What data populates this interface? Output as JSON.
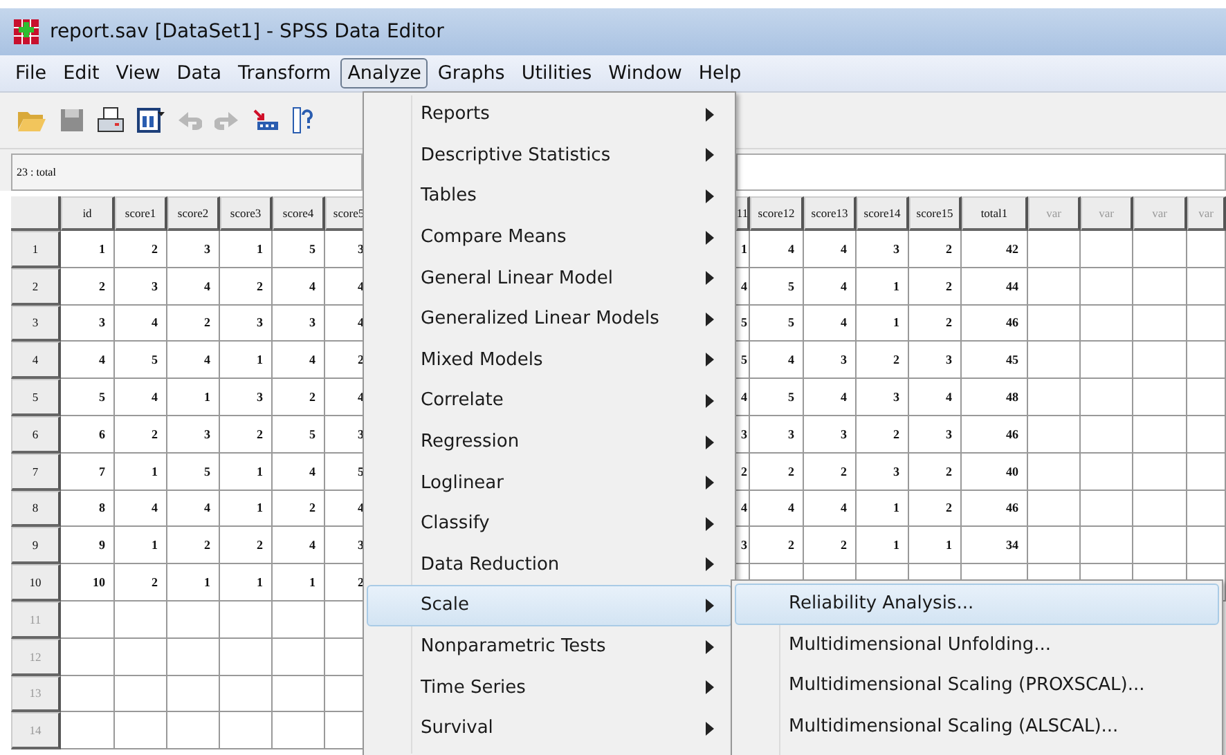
{
  "window": {
    "title": "report.sav [DataSet1] - SPSS Data Editor"
  },
  "menu_bar": [
    {
      "label": "File",
      "selected": false
    },
    {
      "label": "Edit",
      "selected": false
    },
    {
      "label": "View",
      "selected": false
    },
    {
      "label": "Data",
      "selected": false
    },
    {
      "label": "Transform",
      "selected": false
    },
    {
      "label": "Analyze",
      "selected": true
    },
    {
      "label": "Graphs",
      "selected": false
    },
    {
      "label": "Utilities",
      "selected": false
    },
    {
      "label": "Window",
      "selected": false
    },
    {
      "label": "Help",
      "selected": false
    }
  ],
  "cell_editor": {
    "reference": "23 : total"
  },
  "grid": {
    "row_headers": [
      {
        "label": "1",
        "filled": true
      },
      {
        "label": "2",
        "filled": true
      },
      {
        "label": "3",
        "filled": true
      },
      {
        "label": "4",
        "filled": true
      },
      {
        "label": "5",
        "filled": true
      },
      {
        "label": "6",
        "filled": true
      },
      {
        "label": "7",
        "filled": true
      },
      {
        "label": "8",
        "filled": true
      },
      {
        "label": "9",
        "filled": true
      },
      {
        "label": "10",
        "filled": true
      },
      {
        "label": "11",
        "filled": false
      },
      {
        "label": "12",
        "filled": false
      },
      {
        "label": "13",
        "filled": false
      },
      {
        "label": "14",
        "filled": false
      }
    ],
    "left": {
      "columns": [
        {
          "label": "id"
        },
        {
          "label": "score1"
        },
        {
          "label": "score2"
        },
        {
          "label": "score3"
        },
        {
          "label": "score4"
        },
        {
          "label": "score5"
        }
      ],
      "rows": [
        [
          "1",
          "2",
          "3",
          "1",
          "5",
          "3"
        ],
        [
          "2",
          "3",
          "4",
          "2",
          "4",
          "4"
        ],
        [
          "3",
          "4",
          "2",
          "3",
          "3",
          "4"
        ],
        [
          "4",
          "5",
          "4",
          "1",
          "4",
          "2"
        ],
        [
          "5",
          "4",
          "1",
          "3",
          "2",
          "4"
        ],
        [
          "6",
          "2",
          "3",
          "2",
          "5",
          "3"
        ],
        [
          "7",
          "1",
          "5",
          "1",
          "4",
          "5"
        ],
        [
          "8",
          "4",
          "4",
          "1",
          "2",
          "4"
        ],
        [
          "9",
          "1",
          "2",
          "2",
          "4",
          "3"
        ],
        [
          "10",
          "2",
          "1",
          "1",
          "1",
          "2"
        ],
        [],
        [],
        [],
        []
      ]
    },
    "right": {
      "columns": [
        {
          "label": "11",
          "kind": "variable"
        },
        {
          "label": "score12",
          "kind": "variable"
        },
        {
          "label": "score13",
          "kind": "variable"
        },
        {
          "label": "score14",
          "kind": "variable"
        },
        {
          "label": "score15",
          "kind": "variable"
        },
        {
          "label": "total1",
          "kind": "variable"
        },
        {
          "label": "var",
          "kind": "empty"
        },
        {
          "label": "var",
          "kind": "empty"
        },
        {
          "label": "var",
          "kind": "empty"
        },
        {
          "label": "var",
          "kind": "empty"
        }
      ],
      "rows": [
        [
          "1",
          "4",
          "4",
          "3",
          "2",
          "42"
        ],
        [
          "4",
          "5",
          "4",
          "1",
          "2",
          "44"
        ],
        [
          "5",
          "5",
          "4",
          "1",
          "2",
          "46"
        ],
        [
          "5",
          "4",
          "3",
          "2",
          "3",
          "45"
        ],
        [
          "4",
          "5",
          "4",
          "3",
          "4",
          "48"
        ],
        [
          "3",
          "3",
          "3",
          "2",
          "3",
          "46"
        ],
        [
          "2",
          "2",
          "2",
          "3",
          "2",
          "40"
        ],
        [
          "4",
          "4",
          "4",
          "1",
          "2",
          "46"
        ],
        [
          "3",
          "2",
          "2",
          "1",
          "1",
          "34"
        ],
        []
      ]
    }
  },
  "analyze_menu": [
    {
      "label": "Reports",
      "selected": false
    },
    {
      "label": "Descriptive Statistics",
      "selected": false
    },
    {
      "label": "Tables",
      "selected": false
    },
    {
      "label": "Compare Means",
      "selected": false
    },
    {
      "label": "General Linear Model",
      "selected": false
    },
    {
      "label": "Generalized Linear Models",
      "selected": false
    },
    {
      "label": "Mixed Models",
      "selected": false
    },
    {
      "label": "Correlate",
      "selected": false
    },
    {
      "label": "Regression",
      "selected": false
    },
    {
      "label": "Loglinear",
      "selected": false
    },
    {
      "label": "Classify",
      "selected": false
    },
    {
      "label": "Data Reduction",
      "selected": false
    },
    {
      "label": "Scale",
      "selected": true
    },
    {
      "label": "Nonparametric Tests",
      "selected": false
    },
    {
      "label": "Time Series",
      "selected": false
    },
    {
      "label": "Survival",
      "selected": false
    }
  ],
  "scale_submenu": [
    {
      "label": "Reliability Analysis...",
      "selected": true
    },
    {
      "label": "Multidimensional Unfolding...",
      "selected": false
    },
    {
      "label": "Multidimensional Scaling (PROXSCAL)...",
      "selected": false
    },
    {
      "label": "Multidimensional Scaling (ALSCAL)...",
      "selected": false
    }
  ]
}
